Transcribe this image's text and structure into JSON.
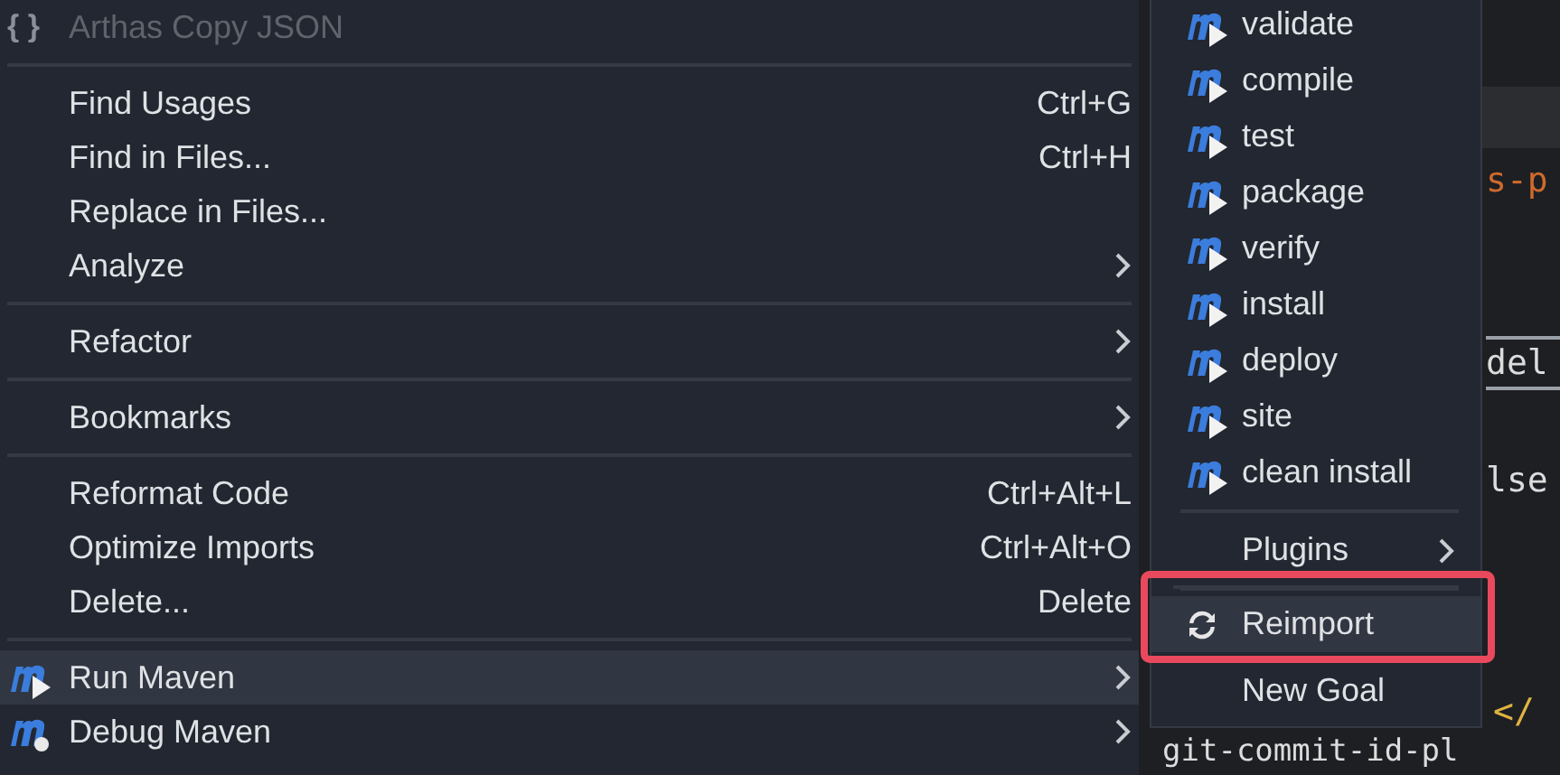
{
  "context_menu": {
    "items": [
      {
        "kind": "item",
        "icon_text": "{ }",
        "label": "Arthas Copy JSON",
        "disabled": true
      },
      {
        "kind": "separator"
      },
      {
        "kind": "item",
        "label": "Find Usages",
        "shortcut": "Ctrl+G"
      },
      {
        "kind": "item",
        "label": "Find in Files...",
        "shortcut": "Ctrl+H"
      },
      {
        "kind": "item",
        "label": "Replace in Files..."
      },
      {
        "kind": "item",
        "label": "Analyze",
        "submenu": true
      },
      {
        "kind": "separator"
      },
      {
        "kind": "item",
        "label": "Refactor",
        "submenu": true
      },
      {
        "kind": "separator"
      },
      {
        "kind": "item",
        "label": "Bookmarks",
        "submenu": true
      },
      {
        "kind": "separator"
      },
      {
        "kind": "item",
        "label": "Reformat Code",
        "shortcut": "Ctrl+Alt+L"
      },
      {
        "kind": "item",
        "label": "Optimize Imports",
        "shortcut": "Ctrl+Alt+O"
      },
      {
        "kind": "item",
        "label": "Delete...",
        "shortcut": "Delete"
      },
      {
        "kind": "separator"
      },
      {
        "kind": "run",
        "label": "Run Maven",
        "submenu": true,
        "selected": true
      },
      {
        "kind": "debug",
        "label": "Debug Maven",
        "submenu": true,
        "selected": false
      }
    ]
  },
  "maven_submenu": {
    "items": [
      {
        "kind": "goal",
        "label": "validate"
      },
      {
        "kind": "goal",
        "label": "compile"
      },
      {
        "kind": "goal",
        "label": "test"
      },
      {
        "kind": "goal",
        "label": "package"
      },
      {
        "kind": "goal",
        "label": "verify"
      },
      {
        "kind": "goal",
        "label": "install"
      },
      {
        "kind": "goal",
        "label": "deploy"
      },
      {
        "kind": "goal",
        "label": "site"
      },
      {
        "kind": "goal",
        "label": "clean install"
      },
      {
        "kind": "separator"
      },
      {
        "kind": "item",
        "label": "Plugins",
        "submenu": true
      },
      {
        "kind": "separator"
      },
      {
        "kind": "reimport",
        "label": "Reimport",
        "selected": true,
        "highlighted": true
      },
      {
        "kind": "item",
        "label": "New Goal"
      }
    ]
  },
  "editor": {
    "lines": [
      {
        "text": "s-p",
        "color": "#cf6a2c"
      },
      {
        "text": "del",
        "color": "#dcdcdc"
      },
      {
        "text": "lse",
        "color": "#dcdcdc"
      },
      {
        "text": "</",
        "color": "#e0b341"
      },
      {
        "text": "git-commit-id-pl",
        "color": "#dcdcdc"
      }
    ]
  }
}
